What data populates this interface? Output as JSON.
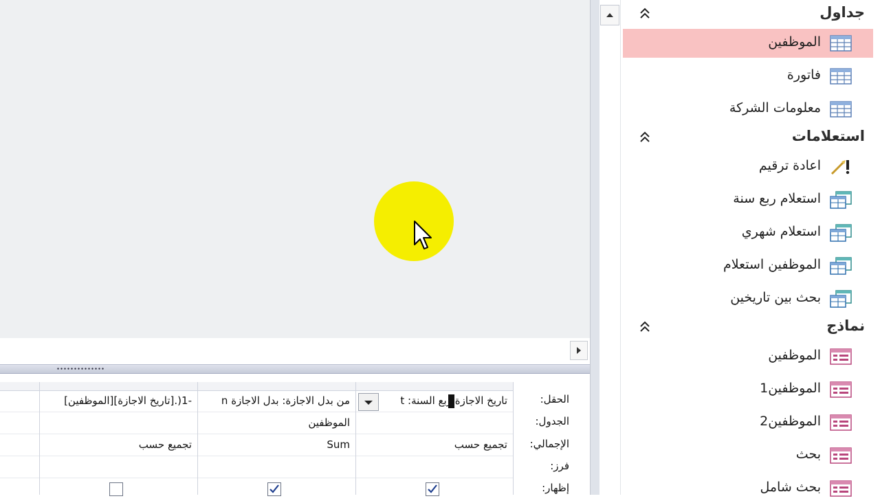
{
  "nav": {
    "sections": [
      {
        "title": "جداول",
        "items": [
          {
            "label": "الموظفين",
            "icon": "table-icon",
            "selected": true
          },
          {
            "label": "فاتورة",
            "icon": "table-icon"
          },
          {
            "label": "معلومات الشركة",
            "icon": "table-icon"
          }
        ]
      },
      {
        "title": "استعلامات",
        "items": [
          {
            "label": "اعادة ترقيم",
            "icon": "action-query-icon"
          },
          {
            "label": "استعلام ربع سنة",
            "icon": "query-icon"
          },
          {
            "label": "استعلام شهري",
            "icon": "query-icon"
          },
          {
            "label": "الموظفين استعلام",
            "icon": "query-icon"
          },
          {
            "label": "بحث بين تاريخين",
            "icon": "query-icon"
          }
        ]
      },
      {
        "title": "نماذج",
        "items": [
          {
            "label": "الموظفين",
            "icon": "form-icon"
          },
          {
            "label": "الموظفين1",
            "icon": "form-icon"
          },
          {
            "label": "الموظفين2",
            "icon": "form-icon"
          },
          {
            "label": "بحث",
            "icon": "form-icon"
          },
          {
            "label": "بحث شامل",
            "icon": "form-icon"
          }
        ]
      }
    ]
  },
  "grid": {
    "row_labels": [
      "الحقل:",
      "الجدول:",
      "الإجمالي:",
      "فرز:",
      "إظهار:"
    ],
    "columns": [
      {
        "field": "تاريخ الاجازة ربع السنة: t",
        "table": "",
        "total": "تجميع حسب",
        "show": true
      },
      {
        "field": "من بدل الاجازة: بدل الاجازة n",
        "table": "الموظفين",
        "total": "Sum",
        "show": true
      },
      {
        "field": "-1(.[تاريخ الاجازة][الموظفين]",
        "table": "",
        "total": "تجميع حسب",
        "show": false
      }
    ]
  },
  "colors": {
    "selected_bg": "#f9c2c2",
    "highlight": "#f5ee00",
    "canvas_bg": "#eef0f2"
  }
}
